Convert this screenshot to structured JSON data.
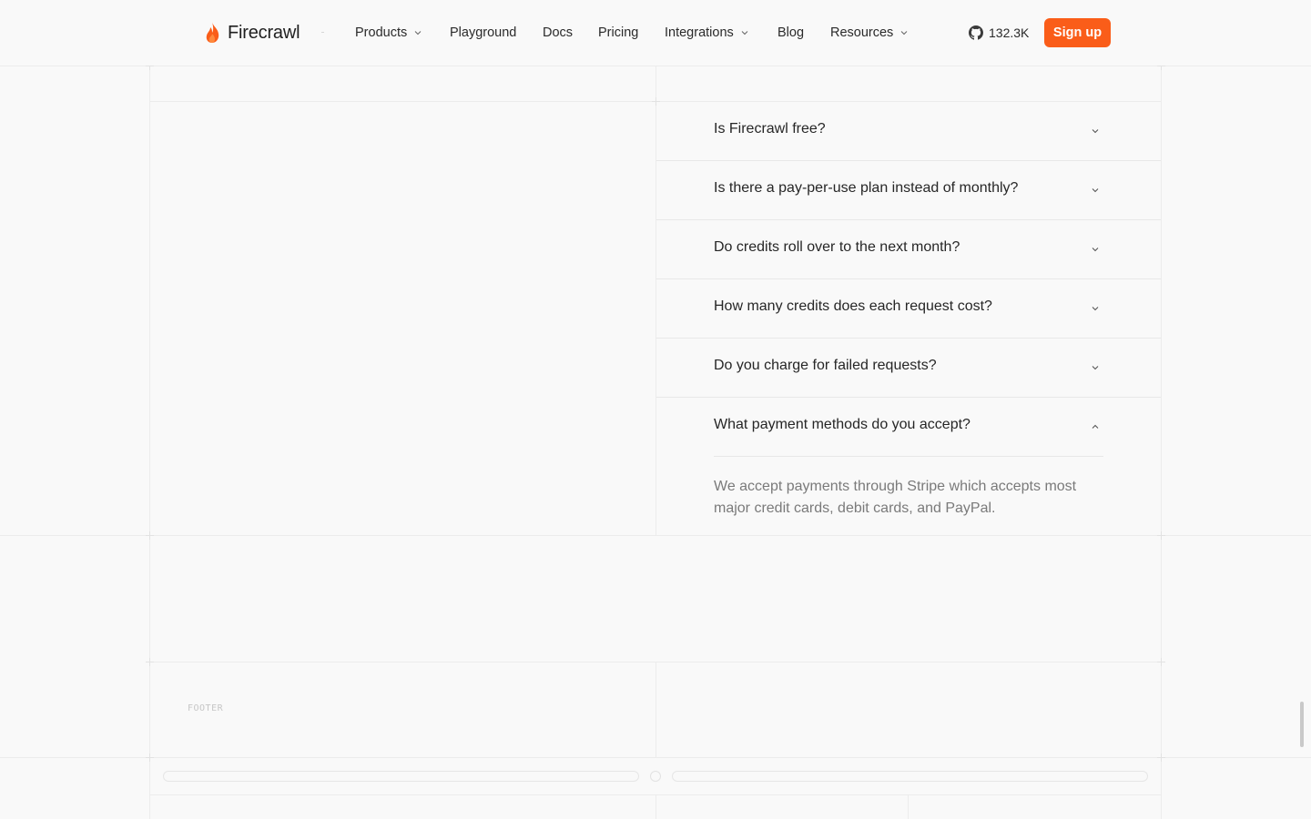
{
  "brand": {
    "name": "Firecrawl",
    "accent": "#fa5d19"
  },
  "nav": {
    "items": [
      {
        "label": "Products",
        "dropdown": true
      },
      {
        "label": "Playground",
        "dropdown": false
      },
      {
        "label": "Docs",
        "dropdown": false
      },
      {
        "label": "Pricing",
        "dropdown": false
      },
      {
        "label": "Integrations",
        "dropdown": true
      },
      {
        "label": "Blog",
        "dropdown": false
      },
      {
        "label": "Resources",
        "dropdown": true
      }
    ]
  },
  "github": {
    "icon": "github-icon",
    "stars": "132.3K"
  },
  "signup": {
    "label": "Sign up"
  },
  "faq": {
    "items": [
      {
        "question": "Is Firecrawl free?",
        "open": false
      },
      {
        "question": "Is there a pay-per-use plan instead of monthly?",
        "open": false
      },
      {
        "question": "Do credits roll over to the next month?",
        "open": false
      },
      {
        "question": "How many credits does each request cost?",
        "open": false
      },
      {
        "question": "Do you charge for failed requests?",
        "open": false
      },
      {
        "question": "What payment methods do you accept?",
        "open": true,
        "answer": "We accept payments through Stripe which accepts most major credit cards, debit cards, and PayPal."
      }
    ]
  },
  "footer": {
    "label": "FOOTER"
  }
}
